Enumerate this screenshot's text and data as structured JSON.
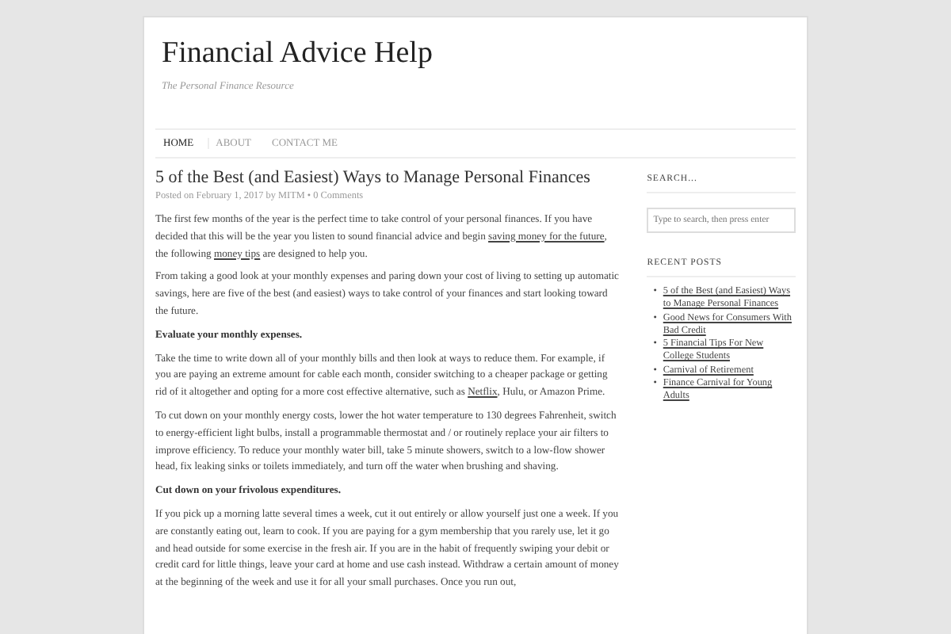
{
  "site": {
    "title": "Financial Advice Help",
    "tagline": "The Personal Finance Resource"
  },
  "nav": [
    {
      "label": "HOME",
      "selected": true
    },
    {
      "label": "ABOUT",
      "selected": false
    },
    {
      "label": "CONTACT ME",
      "selected": false
    }
  ],
  "post": {
    "title": "5 of the Best (and Easiest) Ways to Manage Personal Finances",
    "meta": "Posted on February 1, 2017 by MITM • 0 Comments",
    "blocks": [
      {
        "kind": "paragraph",
        "segments": [
          {
            "text": "The first few months of the year is the perfect time to take control of your personal finances. If you have decided that this will be the year you listen to sound financial advice and begin ",
            "link": false
          },
          {
            "text": "saving money for the future",
            "link": true
          },
          {
            "text": ", the following ",
            "link": false
          },
          {
            "text": "money tips",
            "link": true
          },
          {
            "text": " are designed to help you.",
            "link": false
          }
        ]
      },
      {
        "kind": "paragraph",
        "segments": [
          {
            "text": "From taking a good look at your monthly expenses and paring down your cost of living to setting up automatic savings, here are five of the best (and easiest) ways to take control of your finances and start looking toward the future.",
            "link": false
          }
        ]
      },
      {
        "kind": "heading",
        "segments": [
          {
            "text": "Evaluate your monthly expenses.",
            "link": false
          }
        ]
      },
      {
        "kind": "paragraph",
        "segments": [
          {
            "text": "Take the time to write down all of your monthly bills and then look at ways to reduce them. For example, if you are paying an extreme amount for cable each month, consider switching to a cheaper package or getting rid of it altogether and opting for a more cost effective alternative, such as ",
            "link": false
          },
          {
            "text": "Netflix",
            "link": true
          },
          {
            "text": ", Hulu, or Amazon Prime.",
            "link": false
          }
        ]
      },
      {
        "kind": "paragraph",
        "segments": [
          {
            "text": "To cut down on your monthly energy costs, lower the hot water temperature to 130 degrees Fahrenheit, switch to energy-efficient light bulbs, install a programmable thermostat and / or routinely replace your air filters to improve efficiency. To reduce your monthly water bill, take 5 minute showers, switch to a low-flow shower head, fix leaking sinks or toilets immediately, and turn off the water when brushing and shaving.",
            "link": false
          }
        ]
      },
      {
        "kind": "heading",
        "segments": [
          {
            "text": "Cut down on your frivolous expenditures.",
            "link": false
          }
        ]
      },
      {
        "kind": "paragraph",
        "segments": [
          {
            "text": "If you pick up a morning latte several times a week, cut it out entirely or allow yourself just one a week. If you are constantly eating out, learn to cook. If you are paying for a gym membership that you rarely use, let it go and head outside for some exercise in the fresh air. If you are in the habit of frequently swiping your debit or credit card for little things, leave your card at home and use cash instead. Withdraw a certain amount of money at the beginning of the week and use it for all your small purchases. Once you run out,",
            "link": false
          }
        ]
      }
    ]
  },
  "sidebar": {
    "search_title": "SEARCH...",
    "search_placeholder": "Type to search, then press enter",
    "recent_title": "RECENT POSTS",
    "recent_posts": [
      {
        "marker": "•",
        "title": "5 of the Best (and Easiest) Ways to Manage Personal Finances"
      },
      {
        "marker": "•",
        "title": "Good News for Consumers With Bad Credit"
      },
      {
        "marker": "•",
        "title": "5 Financial Tips For New College Students"
      },
      {
        "marker": "•",
        "title": "Carnival of Retirement"
      },
      {
        "marker": "•",
        "title": "Finance Carnival for Young Adults"
      }
    ]
  }
}
